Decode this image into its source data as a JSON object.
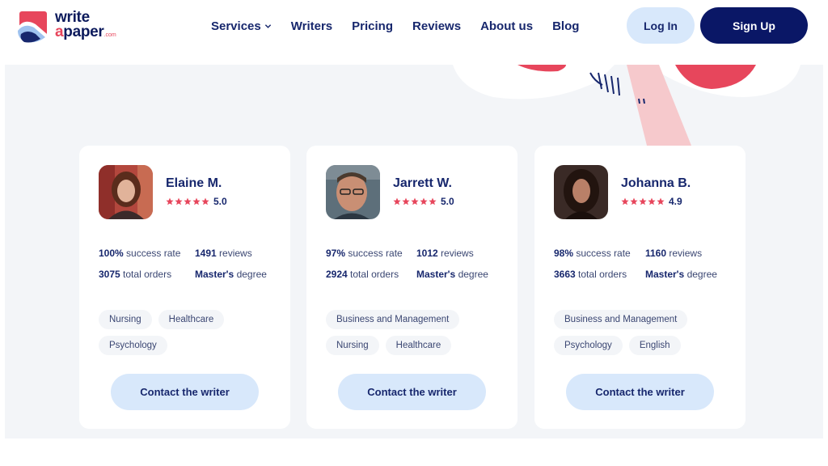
{
  "logo": {
    "line1": "write",
    "line2_a": "a",
    "line2_rest": "paper",
    "suffix": ".com"
  },
  "nav": {
    "items": [
      {
        "label": "Services",
        "has_dropdown": true,
        "icon": "chevron-down-icon"
      },
      {
        "label": "Writers"
      },
      {
        "label": "Pricing"
      },
      {
        "label": "Reviews"
      },
      {
        "label": "About us"
      },
      {
        "label": "Blog"
      }
    ]
  },
  "auth": {
    "login": "Log In",
    "signup": "Sign Up"
  },
  "colors": {
    "navy": "#0a1766",
    "accent": "#e7465c",
    "light_blue": "#d8e8fb",
    "bg": "#f3f5f8"
  },
  "writers": [
    {
      "name": "Elaine M.",
      "rating": "5.0",
      "stars": 5,
      "success_value": "100%",
      "success_label": "success rate",
      "reviews_value": "1491",
      "reviews_label": "reviews",
      "orders_value": "3075",
      "orders_label": "total orders",
      "degree_value": "Master's",
      "degree_label": "degree",
      "tags": [
        "Nursing",
        "Healthcare",
        "Psychology"
      ],
      "contact": "Contact the writer"
    },
    {
      "name": "Jarrett W.",
      "rating": "5.0",
      "stars": 5,
      "success_value": "97%",
      "success_label": "success rate",
      "reviews_value": "1012",
      "reviews_label": "reviews",
      "orders_value": "2924",
      "orders_label": "total orders",
      "degree_value": "Master's",
      "degree_label": "degree",
      "tags": [
        "Business and Management",
        "Nursing",
        "Healthcare"
      ],
      "contact": "Contact the writer"
    },
    {
      "name": "Johanna B.",
      "rating": "4.9",
      "stars": 5,
      "success_value": "98%",
      "success_label": "success rate",
      "reviews_value": "1160",
      "reviews_label": "reviews",
      "orders_value": "3663",
      "orders_label": "total orders",
      "degree_value": "Master's",
      "degree_label": "degree",
      "tags": [
        "Business and Management",
        "Psychology",
        "English"
      ],
      "contact": "Contact the writer"
    }
  ]
}
